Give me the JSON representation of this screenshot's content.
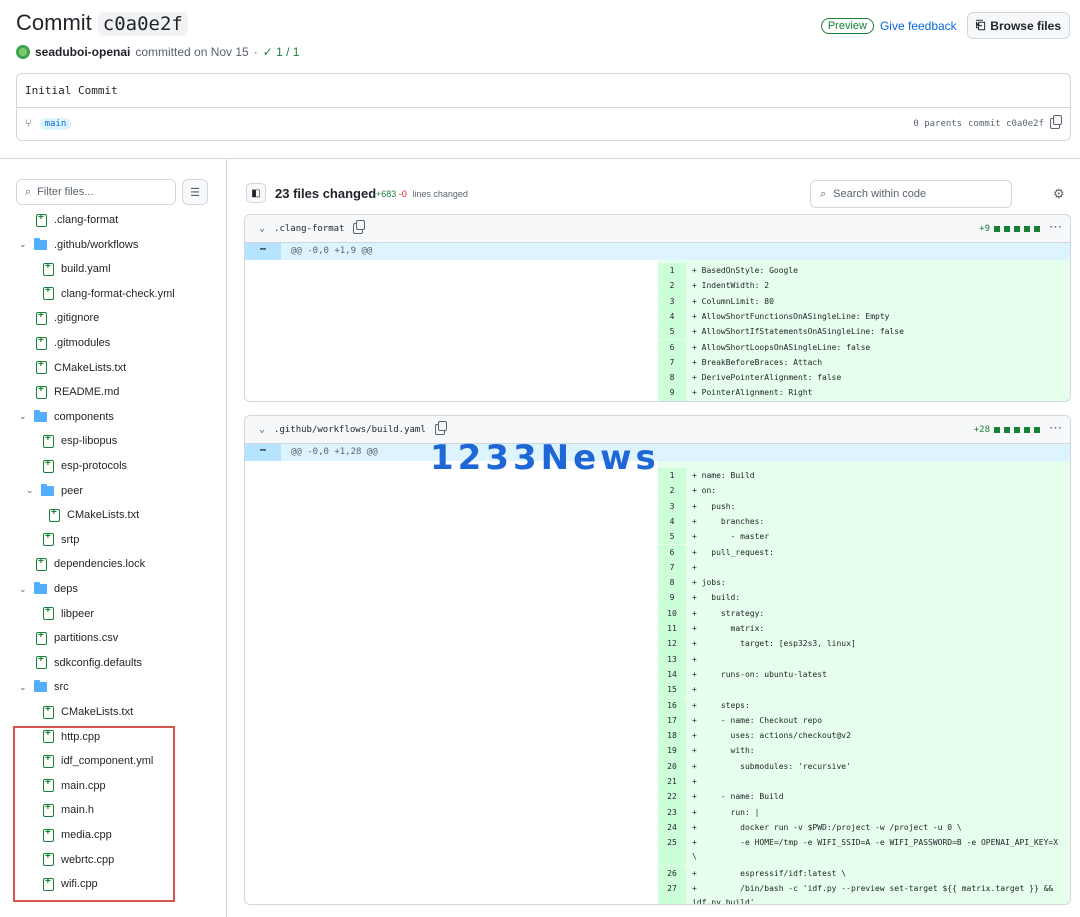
{
  "header": {
    "title_prefix": "Commit",
    "sha": "c0a0e2f",
    "preview_label": "Preview",
    "feedback_label": "Give feedback",
    "browse_label": "Browse files"
  },
  "meta": {
    "author": "seaduboi-openai",
    "committed_text": "committed on Nov 15",
    "separator": "·",
    "checks": "✓ 1 / 1"
  },
  "commit": {
    "message": "Initial Commit",
    "branch": "main",
    "parents": "0 parents",
    "commit_label": "commit c0a0e2f"
  },
  "sidebar": {
    "filter_placeholder": "Filter files...",
    "tree": [
      {
        "label": ".clang-format",
        "kind": "file",
        "depth": 1
      },
      {
        "label": ".github/workflows",
        "kind": "folder",
        "depth": 0
      },
      {
        "label": "build.yaml",
        "kind": "file",
        "depth": 2
      },
      {
        "label": "clang-format-check.yml",
        "kind": "file",
        "depth": 2
      },
      {
        "label": ".gitignore",
        "kind": "file",
        "depth": 1
      },
      {
        "label": ".gitmodules",
        "kind": "file",
        "depth": 1
      },
      {
        "label": "CMakeLists.txt",
        "kind": "file",
        "depth": 1
      },
      {
        "label": "README.md",
        "kind": "file",
        "depth": 1
      },
      {
        "label": "components",
        "kind": "folder",
        "depth": 0
      },
      {
        "label": "esp-libopus",
        "kind": "file",
        "depth": 2
      },
      {
        "label": "esp-protocols",
        "kind": "file",
        "depth": 2
      },
      {
        "label": "peer",
        "kind": "folder",
        "depth": 1
      },
      {
        "label": "CMakeLists.txt",
        "kind": "file",
        "depth": 3
      },
      {
        "label": "srtp",
        "kind": "file",
        "depth": 2
      },
      {
        "label": "dependencies.lock",
        "kind": "file",
        "depth": 1
      },
      {
        "label": "deps",
        "kind": "folder",
        "depth": 0
      },
      {
        "label": "libpeer",
        "kind": "file",
        "depth": 2
      },
      {
        "label": "partitions.csv",
        "kind": "file",
        "depth": 1
      },
      {
        "label": "sdkconfig.defaults",
        "kind": "file",
        "depth": 1
      },
      {
        "label": "src",
        "kind": "folder",
        "depth": 0
      },
      {
        "label": "CMakeLists.txt",
        "kind": "file",
        "depth": 2
      },
      {
        "label": "http.cpp",
        "kind": "file",
        "depth": 2
      },
      {
        "label": "idf_component.yml",
        "kind": "file",
        "depth": 2
      },
      {
        "label": "main.cpp",
        "kind": "file",
        "depth": 2
      },
      {
        "label": "main.h",
        "kind": "file",
        "depth": 2
      },
      {
        "label": "media.cpp",
        "kind": "file",
        "depth": 2
      },
      {
        "label": "webrtc.cpp",
        "kind": "file",
        "depth": 2
      },
      {
        "label": "wifi.cpp",
        "kind": "file",
        "depth": 2
      }
    ]
  },
  "summary": {
    "files_changed": "23 files changed",
    "additions": "+683",
    "deletions": "-0",
    "lines_label": "lines changed",
    "search_placeholder": "Search within code"
  },
  "diffs": [
    {
      "file": ".clang-format",
      "stat": "+9",
      "hunk": "@@ -0,0 +1,9 @@",
      "lines": [
        {
          "n": "1",
          "t": "+ BasedOnStyle: Google"
        },
        {
          "n": "2",
          "t": "+ IndentWidth: 2"
        },
        {
          "n": "3",
          "t": "+ ColumnLimit: 80"
        },
        {
          "n": "4",
          "t": "+ AllowShortFunctionsOnASingleLine: Empty"
        },
        {
          "n": "5",
          "t": "+ AllowShortIfStatementsOnASingleLine: false"
        },
        {
          "n": "6",
          "t": "+ AllowShortLoopsOnASingleLine: false"
        },
        {
          "n": "7",
          "t": "+ BreakBeforeBraces: Attach"
        },
        {
          "n": "8",
          "t": "+ DerivePointerAlignment: false"
        },
        {
          "n": "9",
          "t": "+ PointerAlignment: Right"
        }
      ]
    },
    {
      "file": ".github/workflows/build.yaml",
      "stat": "+28",
      "hunk": "@@ -0,0 +1,28 @@",
      "lines": [
        {
          "n": "1",
          "t": "+ name: Build"
        },
        {
          "n": "2",
          "t": "+ on:"
        },
        {
          "n": "3",
          "t": "+   push:"
        },
        {
          "n": "4",
          "t": "+     branches:"
        },
        {
          "n": "5",
          "t": "+       - master"
        },
        {
          "n": "6",
          "t": "+   pull_request:"
        },
        {
          "n": "7",
          "t": "+"
        },
        {
          "n": "8",
          "t": "+ jobs:"
        },
        {
          "n": "9",
          "t": "+   build:"
        },
        {
          "n": "10",
          "t": "+     strategy:"
        },
        {
          "n": "11",
          "t": "+       matrix:"
        },
        {
          "n": "12",
          "t": "+         target: [esp32s3, linux]"
        },
        {
          "n": "13",
          "t": "+"
        },
        {
          "n": "14",
          "t": "+     runs-on: ubuntu-latest"
        },
        {
          "n": "15",
          "t": "+"
        },
        {
          "n": "16",
          "t": "+     steps:"
        },
        {
          "n": "17",
          "t": "+     - name: Checkout repo"
        },
        {
          "n": "18",
          "t": "+       uses: actions/checkout@v2"
        },
        {
          "n": "19",
          "t": "+       with:"
        },
        {
          "n": "20",
          "t": "+         submodules: 'recursive'"
        },
        {
          "n": "21",
          "t": "+"
        },
        {
          "n": "22",
          "t": "+     - name: Build"
        },
        {
          "n": "23",
          "t": "+       run: |"
        },
        {
          "n": "24",
          "t": "+         docker run -v $PWD:/project -w /project -u 0 \\"
        },
        {
          "n": "25",
          "t": "+         -e HOME=/tmp -e WIFI_SSID=A -e WIFI_PASSWORD=B -e OPENAI_API_KEY=X \\",
          "wrap": true
        },
        {
          "n": "26",
          "t": "+         espressif/idf:latest \\"
        },
        {
          "n": "27",
          "t": "+         /bin/bash -c 'idf.py --preview set-target ${{ matrix.target }} && idf.py build'",
          "wrap": true
        }
      ]
    }
  ],
  "watermark": "1233News"
}
